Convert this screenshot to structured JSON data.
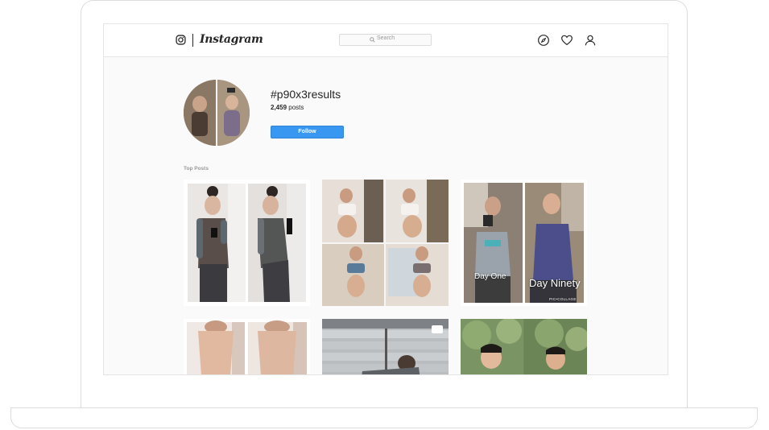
{
  "nav": {
    "wordmark": "Instagram",
    "search_placeholder": "Search",
    "icons": [
      "instagram-glyph-icon",
      "compass-icon",
      "heart-icon",
      "profile-icon"
    ]
  },
  "hashtag": {
    "title": "#p90x3results",
    "post_count": "2,459",
    "post_count_suffix": " posts",
    "follow_label": "Follow"
  },
  "section_label": "Top Posts",
  "posts": [
    {
      "overlay": []
    },
    {
      "overlay": []
    },
    {
      "overlay": [
        "Day One",
        "Day Ninety",
        "PIC•COLLAGE"
      ]
    },
    {
      "overlay": []
    },
    {
      "overlay": []
    },
    {
      "overlay": []
    }
  ],
  "colors": {
    "accent": "#3897f0",
    "text": "#262626",
    "muted": "#999999",
    "background": "#fafafa"
  }
}
